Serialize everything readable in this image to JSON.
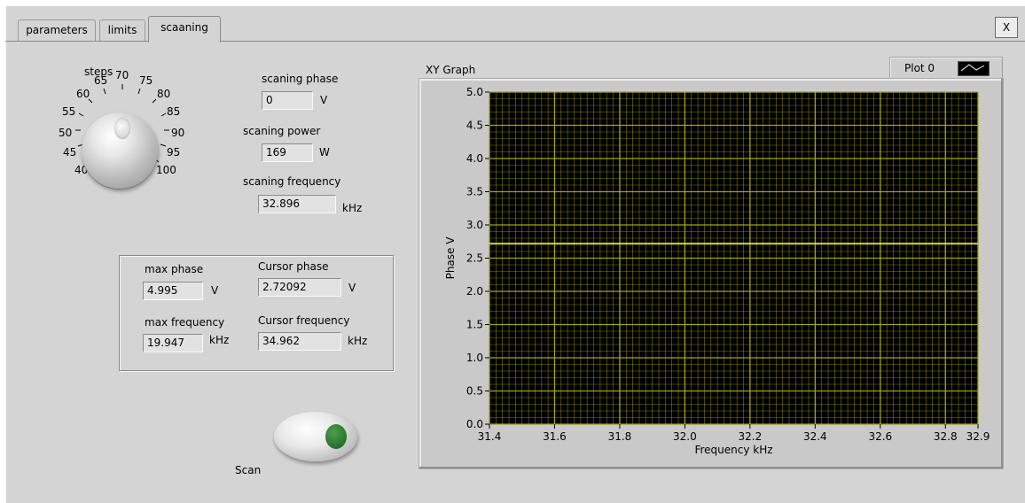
{
  "tabs": [
    {
      "label": "parameters"
    },
    {
      "label": "limits"
    },
    {
      "label": "scaaning"
    }
  ],
  "close_label": "X",
  "knob": {
    "title": "steps",
    "ticks": [
      "40",
      "45",
      "50",
      "55",
      "60",
      "65",
      "70",
      "75",
      "80",
      "85",
      "90",
      "95",
      "100"
    ]
  },
  "scan_params": {
    "phase": {
      "label": "scaning phase",
      "value": "0",
      "unit": "V"
    },
    "power": {
      "label": "scaning power",
      "value": "169",
      "unit": "W"
    },
    "frequency": {
      "label": "scaning frequency",
      "value": "32.896",
      "unit": "kHz"
    }
  },
  "max_group": {
    "max_phase": {
      "label": "max phase",
      "value": "4.995",
      "unit": "V"
    },
    "max_frequency": {
      "label": "max frequency",
      "value": "19.947",
      "unit": "kHz"
    },
    "cursor_phase": {
      "label": "Cursor phase",
      "value": "2.72092",
      "unit": "V"
    },
    "cursor_frequency": {
      "label": "Cursor  frequency",
      "value": "34.962",
      "unit": "kHz"
    }
  },
  "scan_button": {
    "label": "Scan"
  },
  "graph": {
    "title": "XY Graph",
    "legend_label": "Plot 0"
  },
  "colors": {
    "plot_bg": "#000000",
    "grid": "#a3a31a",
    "trace": "#e8e84a",
    "led": "#2f7b32"
  },
  "chart_data": {
    "type": "line",
    "title": "XY Graph",
    "xlabel": "Frequency  kHz",
    "ylabel": "Phase V",
    "xlim": [
      31.4,
      32.9
    ],
    "ylim": [
      0.0,
      5.0
    ],
    "x_ticks": [
      "31.4",
      "31.6",
      "31.8",
      "32.0",
      "32.2",
      "32.4",
      "32.6",
      "32.8",
      "32.9"
    ],
    "x_tick_values": [
      31.4,
      31.6,
      31.8,
      32.0,
      32.2,
      32.4,
      32.6,
      32.8,
      32.9
    ],
    "y_ticks": [
      "0.0",
      "0.5",
      "1.0",
      "1.5",
      "2.0",
      "2.5",
      "3.0",
      "3.5",
      "4.0",
      "4.5",
      "5.0"
    ],
    "y_tick_values": [
      0.0,
      0.5,
      1.0,
      1.5,
      2.0,
      2.5,
      3.0,
      3.5,
      4.0,
      4.5,
      5.0
    ],
    "grid": true,
    "legend": "top-right",
    "series": [
      {
        "name": "Plot 0",
        "x": [
          31.4,
          32.9
        ],
        "y": [
          2.72092,
          2.72092
        ]
      }
    ]
  }
}
